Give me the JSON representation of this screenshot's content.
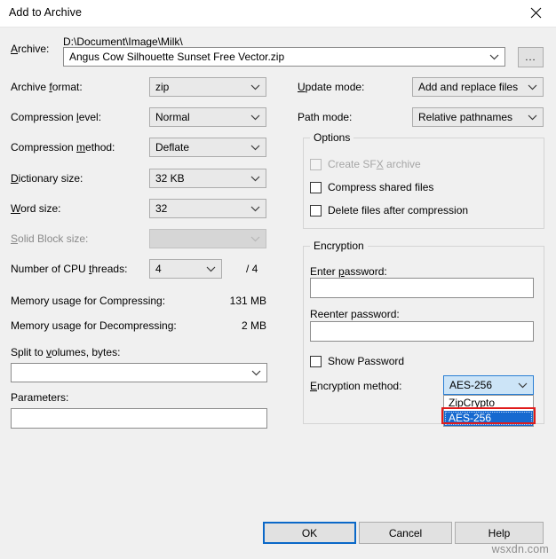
{
  "window": {
    "title": "Add to Archive",
    "close_icon": "close-icon"
  },
  "archive": {
    "label": "Archive:",
    "label_mnemonic": "A",
    "path_text": "D:\\Document\\Image\\Milk\\",
    "file_value": "Angus Cow Silhouette Sunset Free Vector.zip",
    "browse_label": "..."
  },
  "left_fields": [
    {
      "label_pre": "Archive ",
      "label_mn": "f",
      "label_post": "ormat:",
      "value": "zip",
      "disabled": false
    },
    {
      "label_pre": "Compression ",
      "label_mn": "l",
      "label_post": "evel:",
      "value": "Normal",
      "disabled": false
    },
    {
      "label_pre": "Compression ",
      "label_mn": "m",
      "label_post": "ethod:",
      "value": "Deflate",
      "disabled": false
    },
    {
      "label_pre": "",
      "label_mn": "D",
      "label_post": "ictionary size:",
      "value": "32 KB",
      "disabled": false
    },
    {
      "label_pre": "",
      "label_mn": "W",
      "label_post": "ord size:",
      "value": "32",
      "disabled": false
    },
    {
      "label_pre": "",
      "label_mn": "S",
      "label_post": "olid Block size:",
      "value": "",
      "disabled": true
    }
  ],
  "cpu": {
    "label_pre": "Number of CPU ",
    "label_mn": "t",
    "label_post": "hreads:",
    "value": "4",
    "total": "/ 4"
  },
  "memory": [
    {
      "label": "Memory usage for Compressing:",
      "value": "131 MB"
    },
    {
      "label": "Memory usage for Decompressing:",
      "value": "2 MB"
    }
  ],
  "split": {
    "label_pre": "Split to ",
    "label_mn": "v",
    "label_post": "olumes, bytes:",
    "value": ""
  },
  "parameters": {
    "label": "Parameters:",
    "value": ""
  },
  "update_mode": {
    "label_mn": "U",
    "label_post": "pdate mode:",
    "value": "Add and replace files"
  },
  "path_mode": {
    "label": "Path mode:",
    "value": "Relative pathnames"
  },
  "options": {
    "title": "Options",
    "items": [
      {
        "label_pre": "Create SF",
        "label_mn": "X",
        "label_post": " archive",
        "checked": false,
        "disabled": true
      },
      {
        "label_pre": "Compress shared files",
        "label_mn": "",
        "label_post": "",
        "checked": false,
        "disabled": false
      },
      {
        "label_pre": "Delete files after compression",
        "label_mn": "",
        "label_post": "",
        "checked": false,
        "disabled": false
      }
    ]
  },
  "encryption": {
    "title": "Encryption",
    "enter_password_label_pre": "Enter ",
    "enter_password_label_mn": "p",
    "enter_password_label_post": "assword:",
    "enter_password_value": "",
    "reenter_password_label": "Reenter password:",
    "reenter_password_value": "",
    "show_password_label": "Show Password",
    "show_password_checked": false,
    "method_label_mn": "E",
    "method_label_post": "ncryption method:",
    "method_value": "AES-256",
    "method_options": [
      "ZipCrypto",
      "AES-256"
    ],
    "method_selected_index": 1
  },
  "buttons": {
    "ok": "OK",
    "cancel": "Cancel",
    "help": "Help"
  },
  "watermark": "wsxdn.com",
  "colors": {
    "dialog_bg": "#f0f0f0",
    "accent_blue": "#0a68c8",
    "selection_blue": "#1669d0",
    "highlight_red": "#e01b1b"
  }
}
